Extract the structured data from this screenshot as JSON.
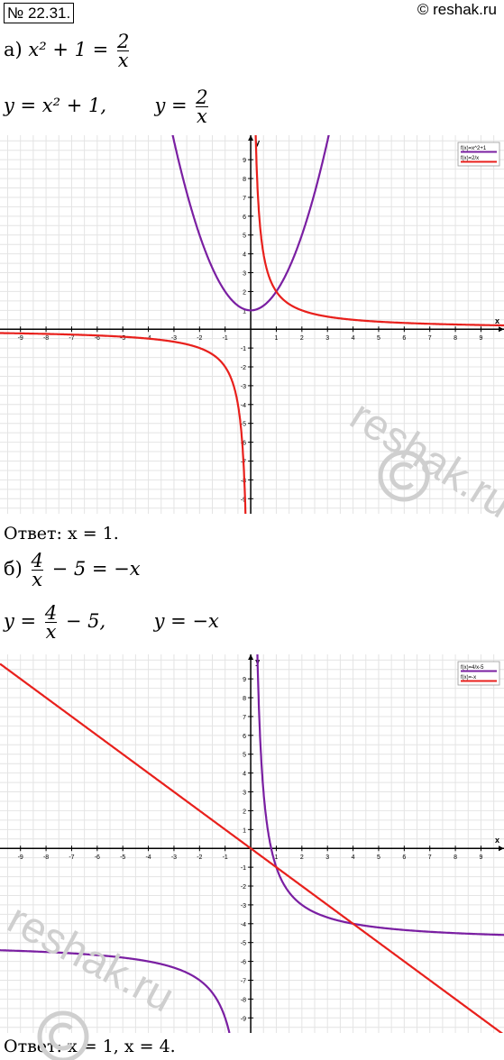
{
  "header": {
    "problem_number": "№ 22.31.",
    "site": "© reshak.ru"
  },
  "part_a": {
    "label": "а)",
    "equation": {
      "left": "x² + 1 =",
      "num": "2",
      "den": "x"
    },
    "functions": {
      "f1": "y = x² + 1,",
      "f2_lhs": "y =",
      "num": "2",
      "den": "x"
    },
    "answer": "Ответ: x = 1."
  },
  "part_b": {
    "label": "б)",
    "equation": {
      "num": "4",
      "den": "x",
      "right": "− 5 = −x"
    },
    "functions": {
      "f1_lhs": "y =",
      "num": "4",
      "den": "x",
      "f1_rhs": "− 5,",
      "f2": "y = −x"
    },
    "answer": "Ответ: x = 1,      x = 4."
  },
  "watermark": "reshak.ru",
  "chart_data": [
    {
      "type": "line",
      "xlabel": "x",
      "ylabel": "y",
      "xlim": [
        -9.8,
        9.9
      ],
      "ylim": [
        -9.8,
        10.3
      ],
      "ticks": [
        -9,
        -8,
        -7,
        -6,
        -5,
        -4,
        -3,
        -2,
        -1,
        1,
        2,
        3,
        4,
        5,
        6,
        7,
        8,
        9
      ],
      "grid": true,
      "legend_position": "top-right",
      "series": [
        {
          "name": "f(x)=x^2+1",
          "formula": "x^2+1",
          "color": "#7a1fa2"
        },
        {
          "name": "f(x)=2/x",
          "formula": "2/x",
          "color": "#e8201c"
        }
      ]
    },
    {
      "type": "line",
      "xlabel": "x",
      "ylabel": "y",
      "xlim": [
        -9.8,
        9.9
      ],
      "ylim": [
        -9.8,
        10.3
      ],
      "ticks": [
        -9,
        -8,
        -7,
        -6,
        -5,
        -4,
        -3,
        -2,
        -1,
        1,
        2,
        3,
        4,
        5,
        6,
        7,
        8,
        9
      ],
      "grid": true,
      "legend_position": "top-right",
      "series": [
        {
          "name": "f(x)=4/x-5",
          "formula": "4/x-5",
          "color": "#7a1fa2"
        },
        {
          "name": "f(x)=-x",
          "formula": "-x",
          "color": "#e8201c"
        }
      ]
    }
  ]
}
